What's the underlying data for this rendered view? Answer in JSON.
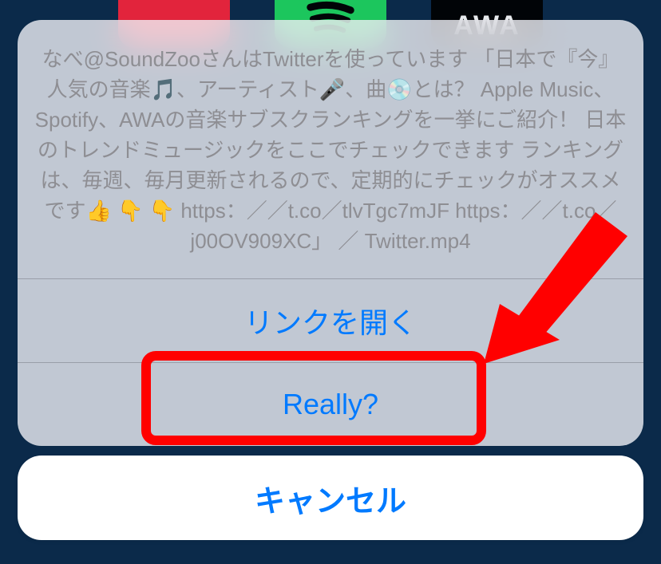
{
  "bg_icons": {
    "spotify_label": "",
    "awa_label": "AWA"
  },
  "sheet": {
    "message": "なべ@SoundZooさんはTwitterを使っています 「日本で『今』人気の音楽🎵、アーティスト🎤、曲💿とは？ Apple Music、Spotify、AWAの音楽サブスクランキングを一挙にご紹介！ 日本のトレンドミュージックをここでチェックできます ランキングは、毎週、毎月更新されるので、定期的にチェックがオススメです👍 👇 👇 https：／／t.co／tlvTgc7mJF https：／／t.co／j00OV909XC」 ／ Twitter.mp4",
    "options": [
      {
        "label": "リンクを開く"
      },
      {
        "label": "Really?"
      }
    ]
  },
  "cancel_label": "キャンセル",
  "annotation": {
    "highlight_target_index": 1
  }
}
